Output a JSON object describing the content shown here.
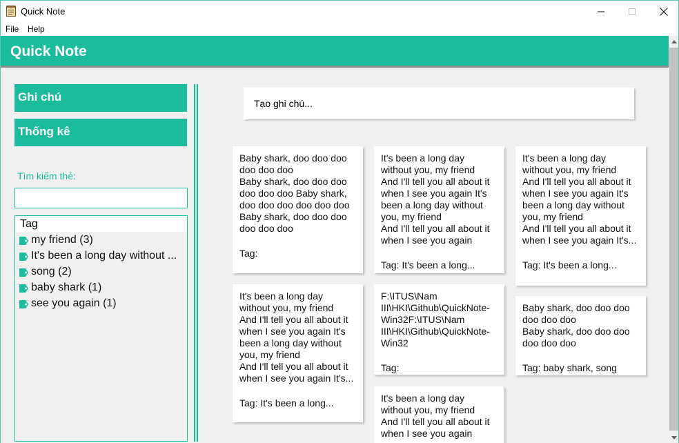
{
  "window": {
    "title": "Quick Note",
    "icon": "notepad-icon"
  },
  "menu": {
    "file": "File",
    "help": "Help"
  },
  "header": {
    "title": "Quick Note",
    "accent": "#1abc9c"
  },
  "sidebar": {
    "nav": [
      "Ghi chú",
      "Thống kê"
    ],
    "search_label": "Tìm kiếm thẻ:",
    "search_value": "",
    "tag_header": "Tag",
    "tags": [
      "my friend (3)",
      "It's been a long day without ...",
      "song (2)",
      "baby shark (1)",
      "see you again (1)"
    ]
  },
  "create_note": {
    "placeholder": "Tạo ghi chú..."
  },
  "notes": [
    {
      "body": "Baby shark, doo doo doo doo doo doo\nBaby shark, doo doo doo doo doo doo Baby shark, doo doo doo doo doo doo\nBaby shark, doo doo doo doo doo doo",
      "tag": "Tag:"
    },
    {
      "body": "It's been a long day without you, my friend\nAnd I'll tell you all about it when I see you again It's been a long day without you, my friend\nAnd I'll tell you all about it when I see you again",
      "tag": "Tag: It's been a long..."
    },
    {
      "body": "It's been a long day without you, my friend\nAnd I'll tell you all about it when I see you again It's been a long day without you, my friend\nAnd I'll tell you all about it when I see you again It's...",
      "tag": "Tag: It's been a long..."
    },
    {
      "body": "It's been a long day without you, my friend\nAnd I'll tell you all about it when I see you again It's been a long day without you, my friend\nAnd I'll tell you all about it when I see you again It's...",
      "tag": "Tag: It's been a long..."
    },
    {
      "body": "F:\\ITUS\\Nam III\\HKI\\Github\\QuickNote-Win32F:\\ITUS\\Nam III\\HKI\\Github\\QuickNote-Win32",
      "tag": "Tag:"
    },
    {
      "body": "Baby shark, doo doo doo doo doo doo\nBaby shark, doo doo doo doo doo doo",
      "tag": "Tag: baby shark, song"
    },
    {
      "body": "It's been a long day without you, my friend\nAnd I'll tell you all about it when I see you again",
      "tag": ""
    }
  ]
}
